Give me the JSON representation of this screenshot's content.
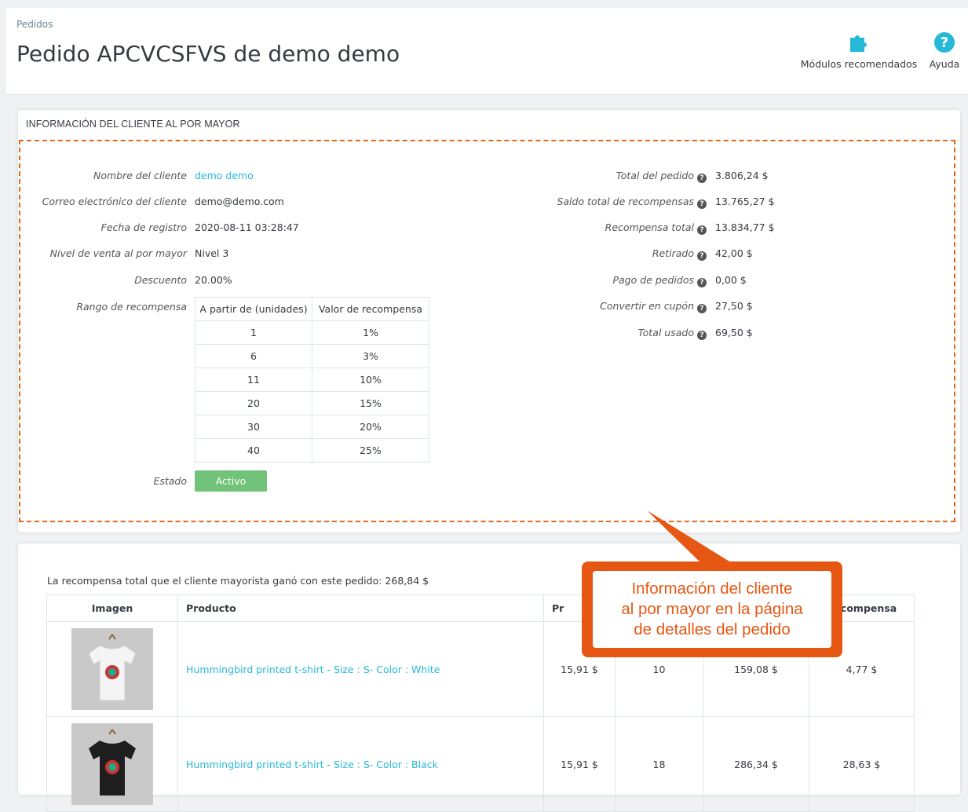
{
  "header": {
    "breadcrumb": "Pedidos",
    "title": "Pedido APCVCSFVS de demo demo",
    "modules_label": "Módulos recomendados",
    "help_label": "Ayuda"
  },
  "panel": {
    "heading": "INFORMACIÓN DEL CLIENTE AL POR MAYOR",
    "left": [
      {
        "label": "Nombre del cliente",
        "value": "demo demo"
      },
      {
        "label": "Correo electrónico del cliente",
        "value": "demo@demo.com"
      },
      {
        "label": "Fecha de registro",
        "value": "2020-08-11 03:28:47"
      },
      {
        "label": "Nivel de venta al por mayor",
        "value": "Nivel 3"
      },
      {
        "label": "Descuento",
        "value": "20.00%"
      },
      {
        "label": "Rango de recompensa"
      },
      {
        "label": "Estado",
        "value": "Activo"
      }
    ],
    "range_headers": [
      "A partir de (unidades)",
      "Valor de recompensa"
    ],
    "range_rows": [
      [
        "1",
        "1%"
      ],
      [
        "6",
        "3%"
      ],
      [
        "11",
        "10%"
      ],
      [
        "20",
        "15%"
      ],
      [
        "30",
        "20%"
      ],
      [
        "40",
        "25%"
      ]
    ],
    "right": [
      {
        "label": "Total del pedido",
        "value": "3.806,24 $"
      },
      {
        "label": "Saldo total de recompensas",
        "value": "13.765,27 $"
      },
      {
        "label": "Recompensa total",
        "value": "13.834,77 $"
      },
      {
        "label": "Retirado",
        "value": "42,00 $"
      },
      {
        "label": "Pago de pedidos",
        "value": "0,00 $"
      },
      {
        "label": "Convertir en cupón",
        "value": "27,50 $"
      },
      {
        "label": "Total usado",
        "value": "69,50 $"
      }
    ]
  },
  "products": {
    "reward_text": "La recompensa total que el cliente mayorista ganó con este pedido: 268,84 $",
    "headers": [
      "Imagen",
      "Producto",
      "Pr",
      "",
      "",
      "Recompensa"
    ],
    "rows": [
      {
        "name": "Hummingbird printed t-shirt - Size : S- Color : White",
        "price": "15,91 $",
        "qty": "10",
        "total": "159,08 $",
        "reward": "4,77 $"
      },
      {
        "name": "Hummingbird printed t-shirt - Size : S- Color : Black",
        "price": "15,91 $",
        "qty": "18",
        "total": "286,34 $",
        "reward": "28,63 $"
      }
    ]
  },
  "callout": {
    "line1": "Información del cliente",
    "line2": "al por mayor en la página",
    "line3": "de detalles del pedido"
  },
  "colors": {
    "accent": "#25b9d7",
    "callout": "#e65713",
    "status": "#70c378"
  }
}
